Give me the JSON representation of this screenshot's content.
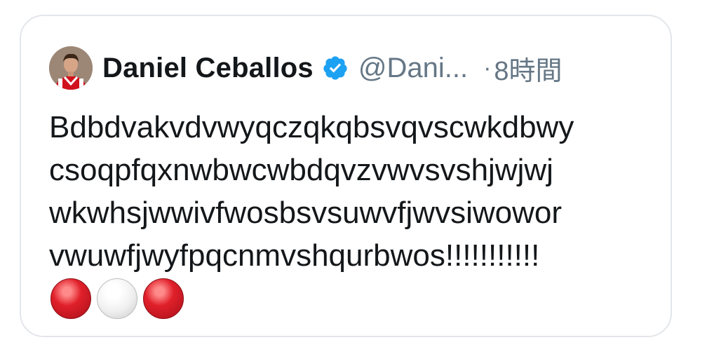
{
  "tweet": {
    "display_name": "Daniel Ceballos",
    "handle": "@Dani...",
    "separator": "·",
    "time": "8時間",
    "verified_icon": "verified-badge-icon",
    "avatar_icon": "profile-photo",
    "body_lines": [
      "Bdbdvakvdvwyqczqkqbsvqvscwkdbwy",
      "csoqpfqxnwbwcwbdqvzvwvsvshjwjwj",
      "wkwhsjwwivfwosbsvsuwvfjwvsiwowor",
      "vwuwfjwyfpqcnmvshqurbwos!!!!!!!!!!!"
    ],
    "emojis": [
      "red-circle",
      "white-circle",
      "red-circle"
    ]
  },
  "colors": {
    "text_primary": "#14171a",
    "text_secondary": "#657786",
    "verified_blue": "#1da1f2",
    "card_border": "#e3e6ea"
  }
}
